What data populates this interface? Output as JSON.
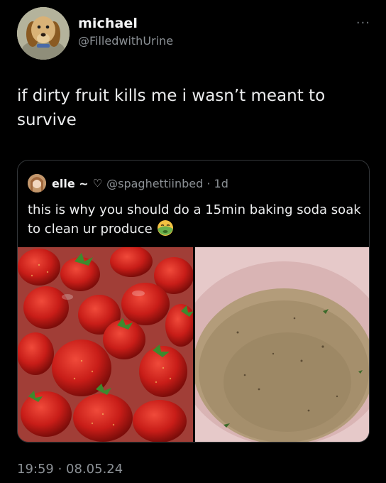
{
  "author": {
    "display_name": "michael",
    "handle": "@FilledwithUrine",
    "avatar_icon": "dog-plush-avatar"
  },
  "more_label": "···",
  "tweet": {
    "text": "if dirty fruit kills me i wasn’t meant to survive",
    "timestamp": "19:59 · 08.05.24"
  },
  "quoted": {
    "display_name": "elle ~",
    "heart": "♡",
    "handle_time": "@spaghettiinbed · 1d",
    "text": "this is why you should do a 15min baking soda soak to clean ur produce",
    "emoji_icon": "nauseated-face-icon",
    "images": [
      "strawberries-in-water",
      "dirty-soak-water-bowl"
    ]
  },
  "colors": {
    "background": "#000000",
    "text": "#e7e9ea",
    "muted": "#8b9095",
    "border": "#333639"
  }
}
